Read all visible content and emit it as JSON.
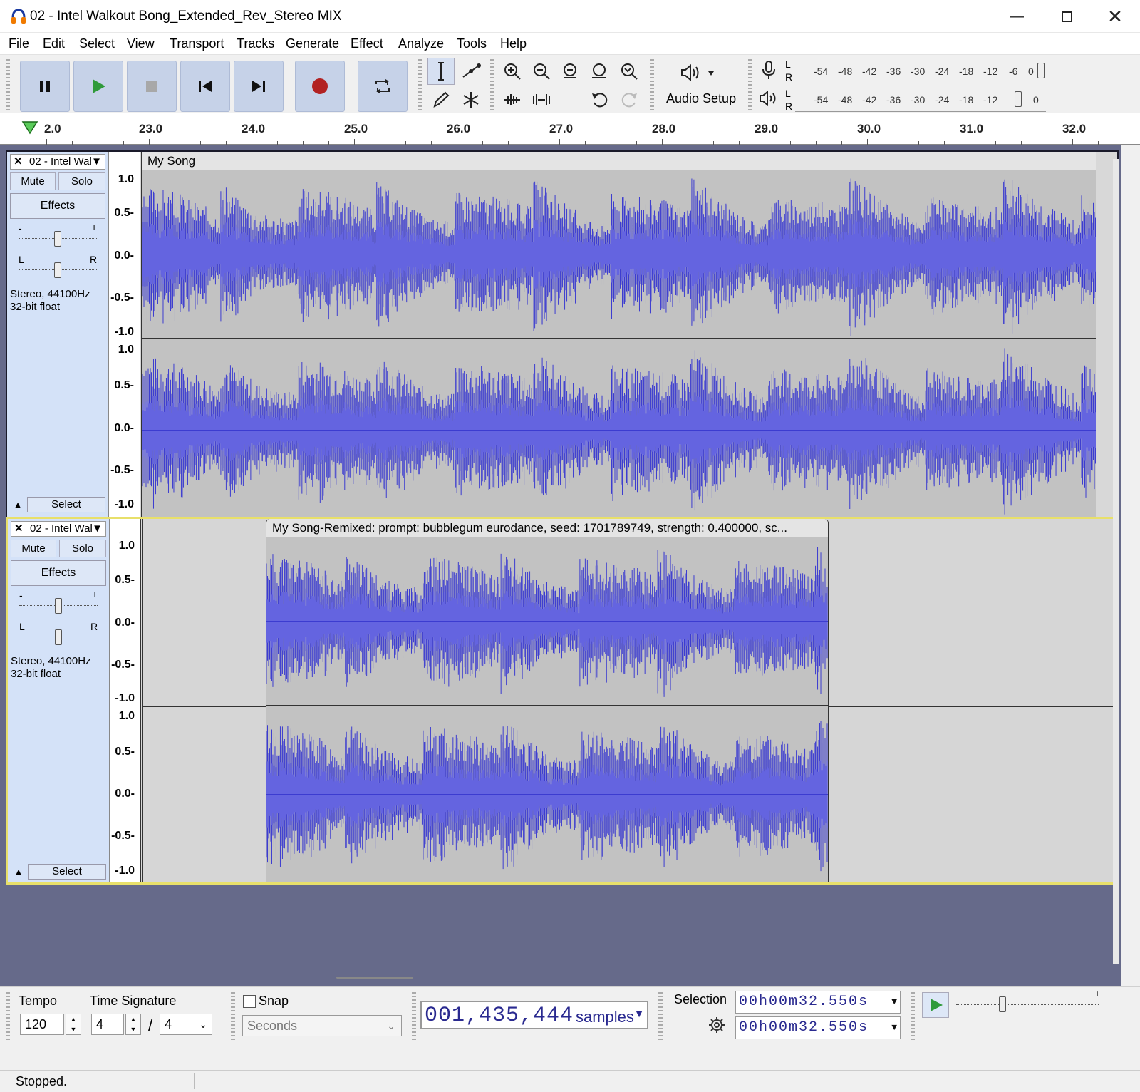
{
  "window": {
    "title": "02 - Intel Walkout Bong_Extended_Rev_Stereo MIX"
  },
  "menu": [
    "File",
    "Edit",
    "Select",
    "View",
    "Transport",
    "Tracks",
    "Generate",
    "Effect",
    "Analyze",
    "Tools",
    "Help"
  ],
  "toolbar": {
    "audio_setup": "Audio Setup",
    "meter_scale": [
      "-54",
      "-48",
      "-42",
      "-36",
      "-30",
      "-24",
      "-18",
      "-12",
      "-6",
      "0"
    ],
    "meter_scale_play": [
      "-54",
      "-48",
      "-42",
      "-36",
      "-30",
      "-24",
      "-18",
      "-12",
      "0"
    ],
    "lr_l": "L",
    "lr_r": "R"
  },
  "ruler": {
    "labels": [
      "2.0",
      "23.0",
      "24.0",
      "25.0",
      "26.0",
      "27.0",
      "28.0",
      "29.0",
      "30.0",
      "31.0",
      "32.0"
    ]
  },
  "tracks": [
    {
      "name": "02 - Intel Wal",
      "mute": "Mute",
      "solo": "Solo",
      "effects": "Effects",
      "gain_minus": "-",
      "gain_plus": "+",
      "pan_l": "L",
      "pan_r": "R",
      "format1": "Stereo, 44100Hz",
      "format2": "32-bit float",
      "select": "Select",
      "clip_name": "My Song",
      "scale": [
        "1.0",
        "0.5-",
        "0.0-",
        "-0.5-",
        "-1.0"
      ]
    },
    {
      "name": "02 - Intel Wal",
      "mute": "Mute",
      "solo": "Solo",
      "effects": "Effects",
      "gain_minus": "-",
      "gain_plus": "+",
      "pan_l": "L",
      "pan_r": "R",
      "format1": "Stereo, 44100Hz",
      "format2": "32-bit float",
      "select": "Select",
      "clip_name": "My Song-Remixed: prompt: bubblegum eurodance, seed: 1701789749, strength: 0.400000, sc...",
      "scale": [
        "1.0",
        "0.5-",
        "0.0-",
        "-0.5-",
        "-1.0"
      ]
    }
  ],
  "bottom": {
    "tempo_label": "Tempo",
    "tempo_value": "120",
    "timesig_label": "Time Signature",
    "timesig_num": "4",
    "timesig_sep": "/",
    "timesig_den": "4",
    "snap_label": "Snap",
    "snap_unit": "Seconds",
    "position": "001,435,444",
    "position_unit": "samples",
    "selection_label": "Selection",
    "sel_start": "00h00m32.550s",
    "sel_end": "00h00m32.550s"
  },
  "status": "Stopped.",
  "colors": {
    "wave": "#3c3cd0",
    "wave_rms": "#6464e0",
    "track_bg": "#c2c2c2",
    "selected_border": "#e8e06a"
  }
}
